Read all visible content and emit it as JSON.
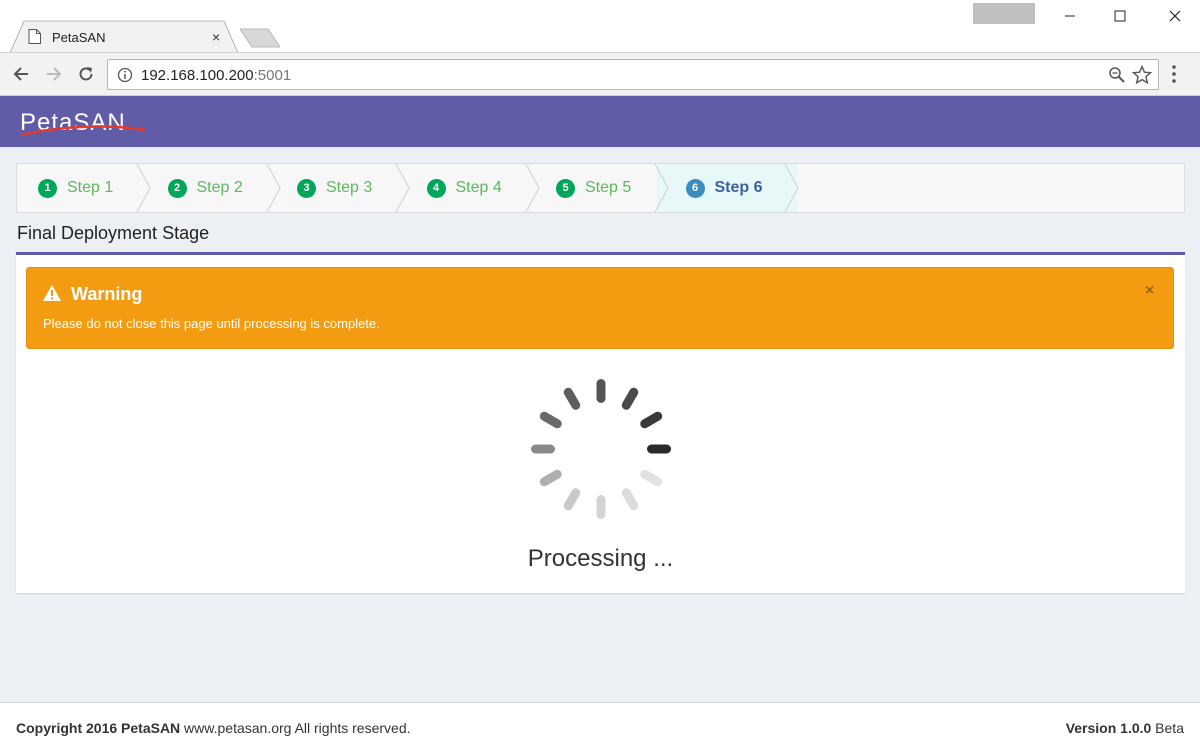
{
  "browser": {
    "tab_title": "PetaSAN",
    "tab_close": "×",
    "url_host": "192.168.100.200",
    "url_port": ":5001",
    "window_minimize": "—",
    "window_maximize": "☐",
    "window_close": "✕"
  },
  "header": {
    "logo_text": "PetaSAN",
    "brand_color": "#605ca8"
  },
  "steps": [
    {
      "num": "1",
      "label": "Step 1",
      "state": "done"
    },
    {
      "num": "2",
      "label": "Step 2",
      "state": "done"
    },
    {
      "num": "3",
      "label": "Step 3",
      "state": "done"
    },
    {
      "num": "4",
      "label": "Step 4",
      "state": "done"
    },
    {
      "num": "5",
      "label": "Step 5",
      "state": "done"
    },
    {
      "num": "6",
      "label": "Step 6",
      "state": "active"
    }
  ],
  "page": {
    "title": "Final Deployment Stage"
  },
  "alert": {
    "title": "Warning",
    "text": "Please do not close this page until processing is complete.",
    "close": "×",
    "color": "#f39c12"
  },
  "status": {
    "processing_text": "Processing ..."
  },
  "footer": {
    "copyright_bold": "Copyright 2016 PetaSAN",
    "copyright_rest": " www.petasan.org All rights reserved.",
    "version_bold": "Version 1.0.0",
    "version_rest": " Beta"
  }
}
